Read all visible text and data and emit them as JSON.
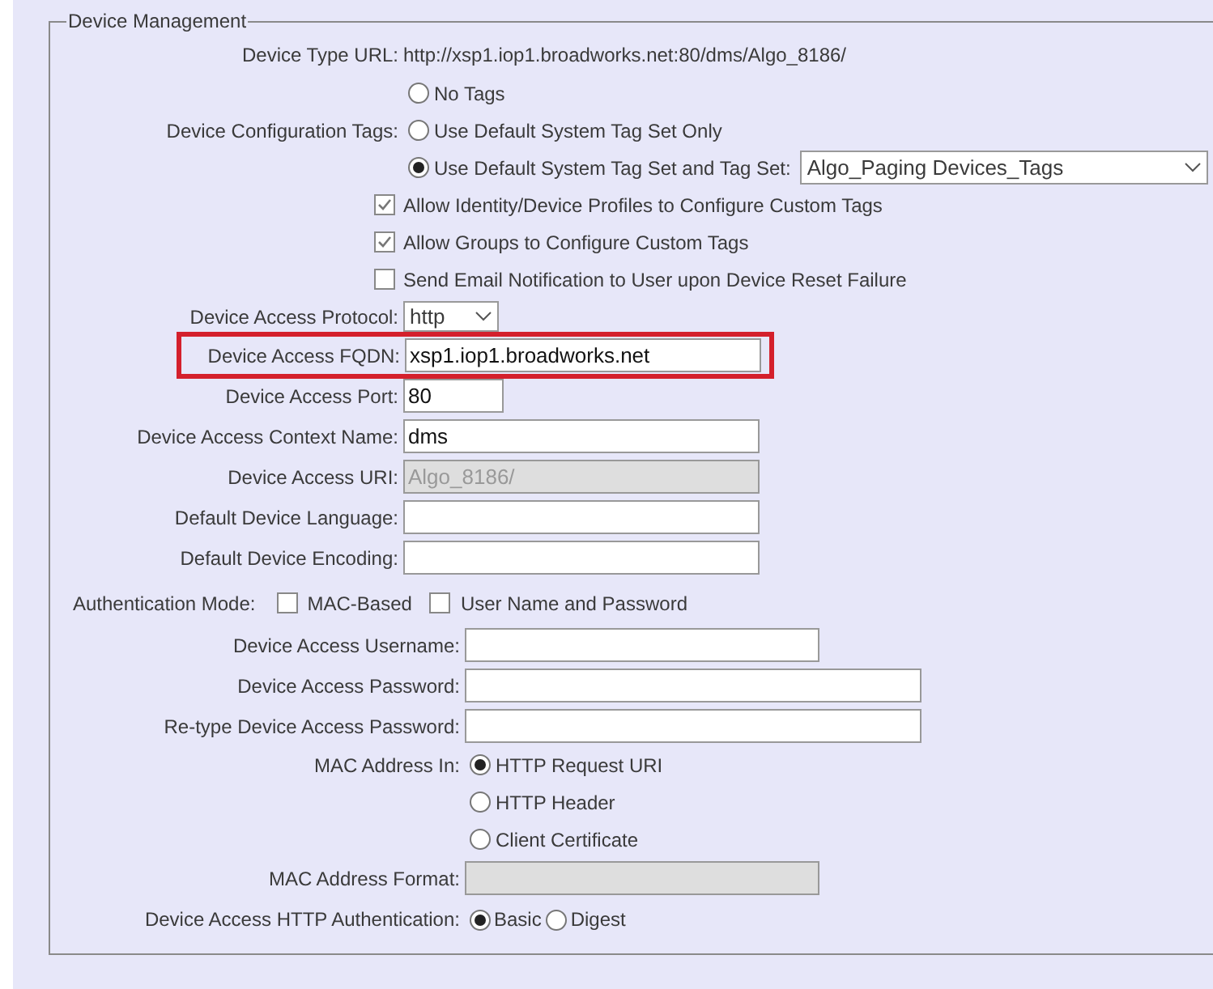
{
  "group": {
    "legend": "Device Management",
    "sections": [
      {
        "rows": [
          {
            "kind": "text",
            "label": "Device Type URL:",
            "value": "http://xsp1.iop1.broadworks.net:80/dms/Algo_8186/"
          },
          {
            "kind": "radio",
            "option": "No Tags",
            "selected": false
          },
          {
            "kind": "radio",
            "label": "Device Configuration Tags:",
            "option": "Use Default System Tag Set Only",
            "selected": false
          },
          {
            "kind": "radio",
            "option": "Use Default System Tag Set and Tag Set:",
            "selected": true,
            "select": "Algo_Paging Devices_Tags"
          },
          {
            "kind": "checkbox",
            "option": "Allow Identity/Device Profiles to Configure Custom Tags",
            "checked": true
          },
          {
            "kind": "checkbox",
            "option": "Allow Groups to Configure Custom Tags",
            "checked": true
          },
          {
            "kind": "checkbox",
            "option": "Send Email Notification to User upon Device Reset Failure",
            "checked": false
          },
          {
            "kind": "select",
            "label": "Device Access Protocol:",
            "value": "http"
          },
          {
            "kind": "field",
            "label": "Device Access FQDN:",
            "value": "xsp1.iop1.broadworks.net",
            "highlighted": true,
            "disabled": false
          },
          {
            "kind": "short_field",
            "label": "Device Access Port:",
            "value": "80",
            "highlighted": false,
            "disabled": false
          },
          {
            "kind": "field",
            "label": "Device Access Context Name:",
            "value": "dms",
            "highlighted": false,
            "disabled": false
          },
          {
            "kind": "field",
            "label": "Device Access URI:",
            "value": "Algo_8186/",
            "highlighted": false,
            "disabled": true
          },
          {
            "kind": "field",
            "label": "Default Device Language:",
            "highlighted": false,
            "disabled": false
          },
          {
            "kind": "field",
            "label": "Default Device Encoding:",
            "highlighted": false,
            "disabled": false
          }
        ]
      },
      {
        "rows": [
          {
            "kind": "inline_checks",
            "label": "Authentication Mode:",
            "options": [
              {
                "label": "MAC-Based",
                "checked": false
              },
              {
                "label": "User Name and Password",
                "checked": false
              }
            ]
          },
          {
            "kind": "field",
            "label": "Device Access Username:",
            "highlighted": false,
            "disabled": false
          },
          {
            "kind": "wide_field",
            "label": "Device Access Password:",
            "highlighted": false,
            "disabled": false
          },
          {
            "kind": "wide_field",
            "label": "Re-type Device Access Password:",
            "highlighted": false,
            "disabled": false
          },
          {
            "kind": "radio",
            "label": "MAC Address In:",
            "option": "HTTP Request URI",
            "selected": true
          },
          {
            "kind": "radio",
            "option": "HTTP Header",
            "selected": false
          },
          {
            "kind": "radio",
            "option": "Client Certificate",
            "selected": false
          },
          {
            "kind": "field",
            "label": "MAC Address Format:",
            "highlighted": false,
            "disabled": true
          },
          {
            "kind": "inline_radios",
            "label": "Device Access HTTP Authentication:",
            "options": [
              {
                "label": "Basic",
                "selected": true
              },
              {
                "label": "Digest",
                "selected": false
              }
            ]
          }
        ]
      }
    ]
  }
}
